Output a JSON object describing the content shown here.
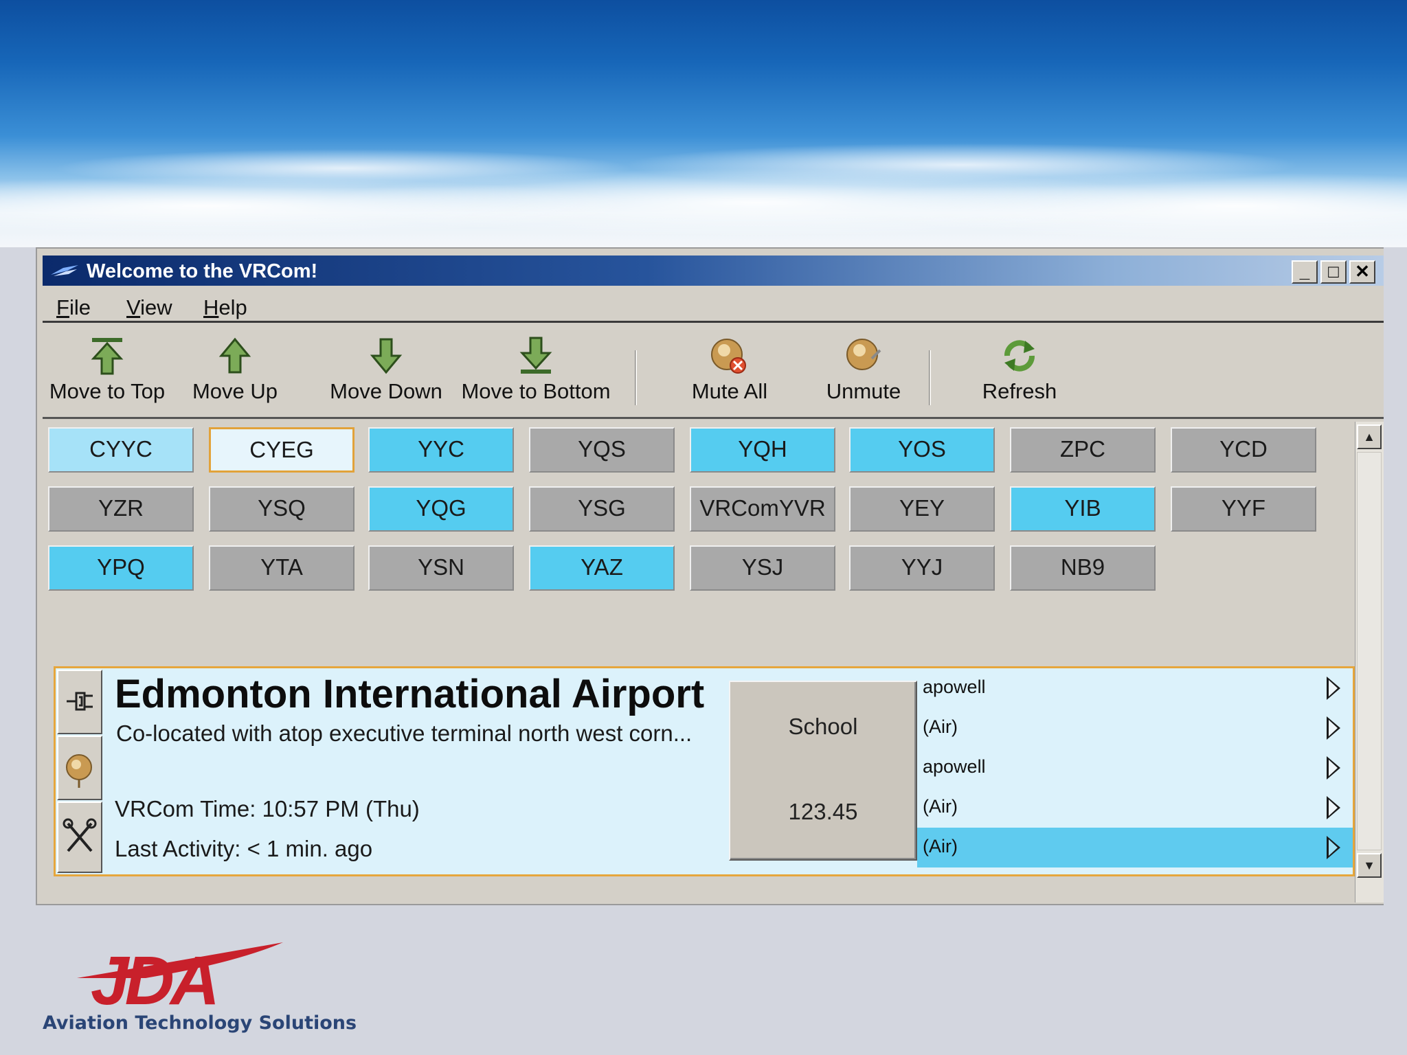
{
  "window": {
    "title": "Welcome to the VRCom!",
    "controls": [
      "_",
      "□",
      "✕"
    ]
  },
  "menu": {
    "items": [
      {
        "key": "F",
        "rest": "ile"
      },
      {
        "key": "V",
        "rest": "iew"
      },
      {
        "key": "H",
        "rest": "elp"
      }
    ]
  },
  "toolbar": {
    "buttons": [
      {
        "label": "Move to Top",
        "icon": "move-to-top-icon"
      },
      {
        "label": "Move Up",
        "icon": "move-up-icon"
      },
      {
        "label": "Move Down",
        "icon": "move-down-icon"
      },
      {
        "label": "Move to Bottom",
        "icon": "move-to-bottom-icon"
      },
      {
        "label": "Mute All",
        "icon": "mute-all-icon"
      },
      {
        "label": "Unmute",
        "icon": "unmute-icon"
      },
      {
        "label": "Refresh",
        "icon": "refresh-icon"
      }
    ]
  },
  "channels": {
    "rows": [
      [
        {
          "label": "CYYC",
          "state": "light"
        },
        {
          "label": "CYEG",
          "state": "selected"
        },
        {
          "label": "YYC",
          "state": "active"
        },
        {
          "label": "YQS",
          "state": "inactive"
        },
        {
          "label": "YQH",
          "state": "active"
        },
        {
          "label": "YOS",
          "state": "active"
        },
        {
          "label": "ZPC",
          "state": "inactive"
        },
        {
          "label": "YCD",
          "state": "inactive"
        }
      ],
      [
        {
          "label": "YZR",
          "state": "inactive"
        },
        {
          "label": "YSQ",
          "state": "inactive"
        },
        {
          "label": "YQG",
          "state": "active"
        },
        {
          "label": "YSG",
          "state": "inactive"
        },
        {
          "label": "VRComYVR",
          "state": "inactive"
        },
        {
          "label": "YEY",
          "state": "inactive"
        },
        {
          "label": "YIB",
          "state": "active"
        },
        {
          "label": "YYF",
          "state": "inactive"
        }
      ],
      [
        {
          "label": "YPQ",
          "state": "active"
        },
        {
          "label": "YTA",
          "state": "inactive"
        },
        {
          "label": "YSN",
          "state": "inactive"
        },
        {
          "label": "YAZ",
          "state": "active"
        },
        {
          "label": "YSJ",
          "state": "inactive"
        },
        {
          "label": "YYJ",
          "state": "inactive"
        },
        {
          "label": "NB9",
          "state": "inactive"
        }
      ]
    ]
  },
  "panel": {
    "name": "Edmonton International Airport",
    "description": "Co-located with atop executive terminal north west corn...",
    "time": "VRCom Time: 10:57 PM (Thu)",
    "activity": "Last Activity: < 1 min. ago",
    "frequency": {
      "name": "School",
      "value": "123.45"
    },
    "users": [
      {
        "name": "apowell",
        "highlighted": false
      },
      {
        "name": "(Air)",
        "highlighted": false
      },
      {
        "name": "apowell",
        "highlighted": false
      },
      {
        "name": "(Air)",
        "highlighted": false
      },
      {
        "name": "(Air)",
        "highlighted": true
      }
    ]
  },
  "branding": {
    "logo_text": "JDA",
    "tagline": "Aviation Technology Solutions"
  },
  "colors": {
    "active_channel": "#55ccf0",
    "inactive_channel": "#a9a9a9",
    "selected_border": "#e2a23a",
    "title_bar": "#0b2a6b",
    "logo_red": "#c8202b",
    "tagline": "#2a4576"
  }
}
